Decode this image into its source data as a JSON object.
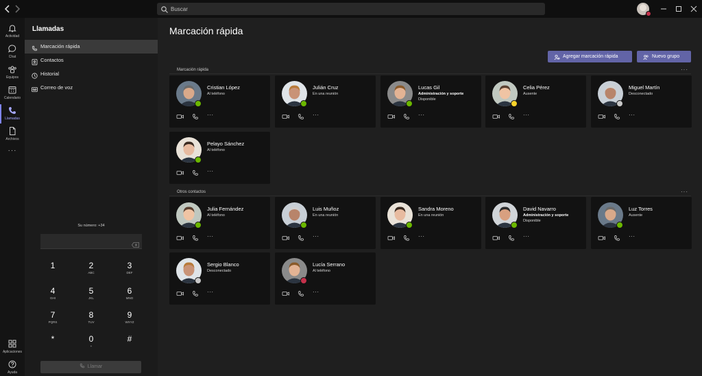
{
  "titlebar": {
    "search_placeholder": "Buscar",
    "back_icon": "chevron-left-icon",
    "forward_icon": "chevron-right-icon",
    "user_presence_color": "#c4314b"
  },
  "rail": {
    "items": [
      {
        "label": "Actividad",
        "icon": "bell-icon"
      },
      {
        "label": "Chat",
        "icon": "chat-icon"
      },
      {
        "label": "Equipos",
        "icon": "teams-icon"
      },
      {
        "label": "Calendario",
        "icon": "calendar-icon"
      },
      {
        "label": "Llamadas",
        "icon": "phone-icon",
        "active": true
      },
      {
        "label": "Archivos",
        "icon": "file-icon"
      }
    ],
    "more": "···",
    "apps_label": "Aplicaciones",
    "help_label": "Ayuda"
  },
  "panel": {
    "title": "Llamadas",
    "menu": [
      {
        "label": "Marcación rápida",
        "icon": "phone-icon",
        "active": true
      },
      {
        "label": "Contactos",
        "icon": "contacts-icon"
      },
      {
        "label": "Historial",
        "icon": "history-icon"
      },
      {
        "label": "Correo de voz",
        "icon": "voicemail-icon"
      }
    ],
    "my_number": "Su número: +34",
    "keypad": [
      {
        "d": "1",
        "l": ""
      },
      {
        "d": "2",
        "l": "ABC"
      },
      {
        "d": "3",
        "l": "DEF"
      },
      {
        "d": "4",
        "l": "GHI"
      },
      {
        "d": "5",
        "l": "JKL"
      },
      {
        "d": "6",
        "l": "MNO"
      },
      {
        "d": "7",
        "l": "PQRS"
      },
      {
        "d": "8",
        "l": "TUV"
      },
      {
        "d": "9",
        "l": "WXYZ"
      },
      {
        "d": "*",
        "l": ""
      },
      {
        "d": "0",
        "l": "+"
      },
      {
        "d": "#",
        "l": ""
      }
    ],
    "call_label": "Llamar"
  },
  "main": {
    "title": "Marcación rápida",
    "add_speed_dial": "Agregar marcación rápida",
    "new_group": "Nuevo grupo",
    "speed_dial_section": "Marcación rápida",
    "other_section": "Otros contactos",
    "section_more": "···",
    "colors": {
      "available": "#6bb700",
      "away": "#f8d22a",
      "offline": "#c8c8c8",
      "busy": "#c4314b",
      "accent": "#6264a7"
    },
    "speed_dial": [
      {
        "name": "Cristian López",
        "status": "Al teléfono",
        "presence": "available"
      },
      {
        "name": "Julián Cruz",
        "status": "En una reunión",
        "presence": "available"
      },
      {
        "name": "Lucas Gil",
        "status": "Administración y soporte",
        "status2": "Disponible",
        "presence": "available"
      },
      {
        "name": "Celia Pérez",
        "status": "Ausente",
        "presence": "away"
      },
      {
        "name": "Miguel Martín",
        "status": "Desconectado",
        "presence": "offline"
      },
      {
        "name": "Pelayo Sánchez",
        "status": "Al teléfono",
        "presence": "available"
      }
    ],
    "other_contacts": [
      {
        "name": "Julia Fernández",
        "status": "Al teléfono",
        "presence": "available"
      },
      {
        "name": "Luis Muñoz",
        "status": "En una reunión",
        "presence": "available"
      },
      {
        "name": "Sandra Moreno",
        "status": "En una reunión",
        "presence": "available"
      },
      {
        "name": "David Navarro",
        "status": "Administración y soporte",
        "status2": "Disponible",
        "presence": "available"
      },
      {
        "name": "Luz Torres",
        "status": "Ausente",
        "presence": "available"
      },
      {
        "name": "Sergio Blanco",
        "status": "Desconectado",
        "presence": "offline"
      },
      {
        "name": "Lucía Serrano",
        "status": "Al teléfono",
        "presence": "busy"
      }
    ],
    "card_actions": [
      "video-call-icon",
      "audio-call-icon",
      "more-options-icon"
    ],
    "more_glyph": "···"
  }
}
